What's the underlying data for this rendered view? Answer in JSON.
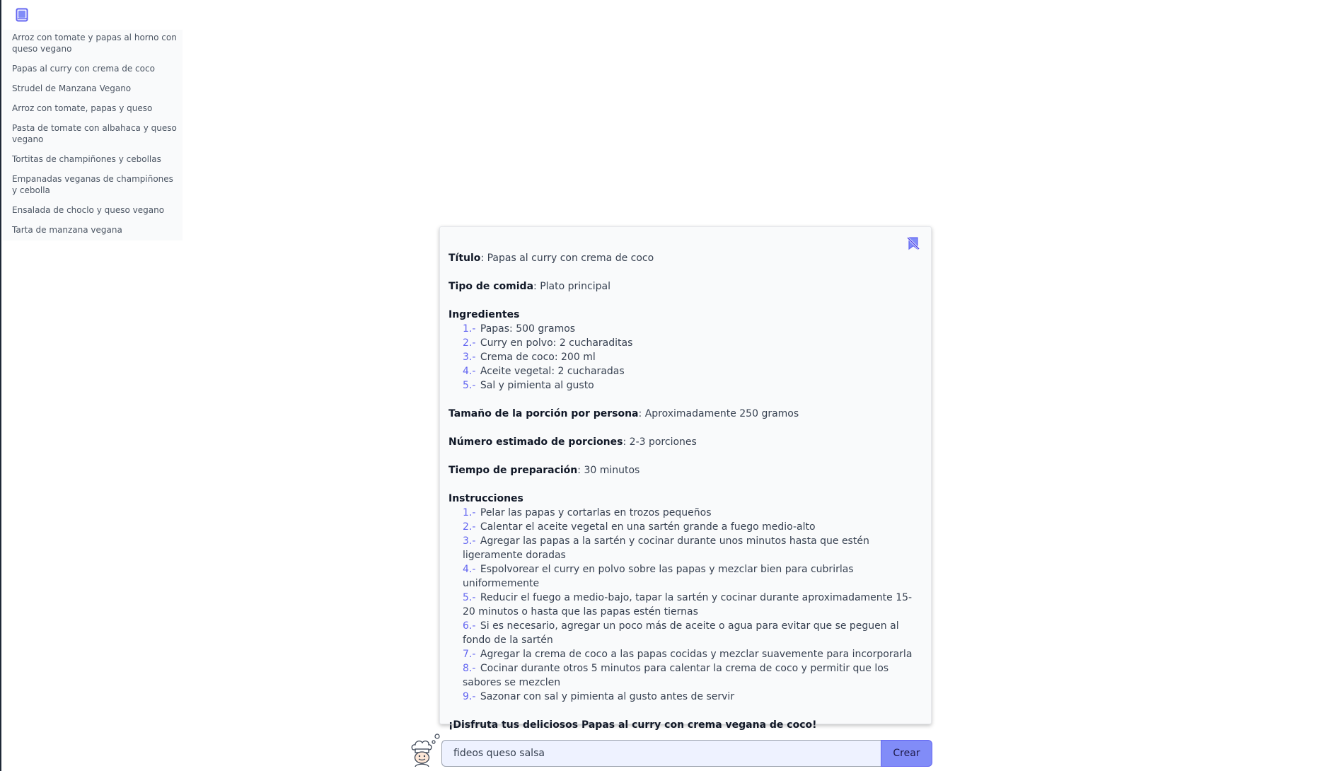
{
  "sidebar": {
    "toggle_icon": "book-icon",
    "history": [
      "Arroz con tomate y papas al horno con queso vegano",
      "Papas al curry con crema de coco",
      "Strudel de Manzana Vegano",
      "Arroz con tomate, papas y queso",
      "Pasta de tomate con albahaca y queso vegano",
      "Tortitas de champiñones y cebollas",
      "Empanadas veganas de champiñones y cebolla",
      "Ensalada de choclo y queso vegano",
      "Tarta de manzana vegana"
    ]
  },
  "recipe": {
    "action_icon": "bookmark-off-icon",
    "title_label": "Título",
    "title_value": "Papas al curry con crema de coco",
    "type_label": "Tipo de comida",
    "type_value": "Plato principal",
    "ingredients_label": "Ingredientes",
    "ingredients": [
      {
        "num": "1.-",
        "text": "Papas: 500 gramos"
      },
      {
        "num": "2.-",
        "text": "Curry en polvo: 2 cucharaditas"
      },
      {
        "num": "3.-",
        "text": "Crema de coco: 200 ml"
      },
      {
        "num": "4.-",
        "text": "Aceite vegetal: 2 cucharadas"
      },
      {
        "num": "5.-",
        "text": "Sal y pimienta al gusto"
      }
    ],
    "portion_label": "Tamaño de la porción por persona",
    "portion_value": "Aproximadamente 250 gramos",
    "servings_label": "Número estimado de porciones",
    "servings_value": "2-3 porciones",
    "prep_label": "Tiempo de preparación",
    "prep_value": "30 minutos",
    "instructions_label": "Instrucciones",
    "instructions": [
      {
        "num": "1.-",
        "text": "Pelar las papas y cortarlas en trozos pequeños"
      },
      {
        "num": "2.-",
        "text": "Calentar el aceite vegetal en una sartén grande a fuego medio-alto"
      },
      {
        "num": "3.-",
        "text": "Agregar las papas a la sartén y cocinar durante unos minutos hasta que estén ligeramente doradas"
      },
      {
        "num": "4.-",
        "text": "Espolvorear el curry en polvo sobre las papas y mezclar bien para cubrirlas uniformemente"
      },
      {
        "num": "5.-",
        "text": "Reducir el fuego a medio-bajo, tapar la sartén y cocinar durante aproximadamente 15-20 minutos o hasta que las papas estén tiernas"
      },
      {
        "num": "6.-",
        "text": "Si es necesario, agregar un poco más de aceite o agua para evitar que se peguen al fondo de la sartén"
      },
      {
        "num": "7.-",
        "text": "Agregar la crema de coco a las papas cocidas y mezclar suavemente para incorporarla"
      },
      {
        "num": "8.-",
        "text": "Cocinar durante otros 5 minutos para calentar la crema de coco y permitir que los sabores se mezclen"
      },
      {
        "num": "9.-",
        "text": "Sazonar con sal y pimienta al gusto antes de servir"
      }
    ],
    "closing": "¡Disfruta tus deliciosos Papas al curry con crema vegana de coco!"
  },
  "prompt": {
    "avatar_icon": "chef-avatar-icon",
    "input_value": "fideos queso salsa",
    "create_label": "Crear"
  },
  "colors": {
    "accent": "#818cf8",
    "list_number": "#6366f1",
    "card_bg": "#f9fafb"
  }
}
